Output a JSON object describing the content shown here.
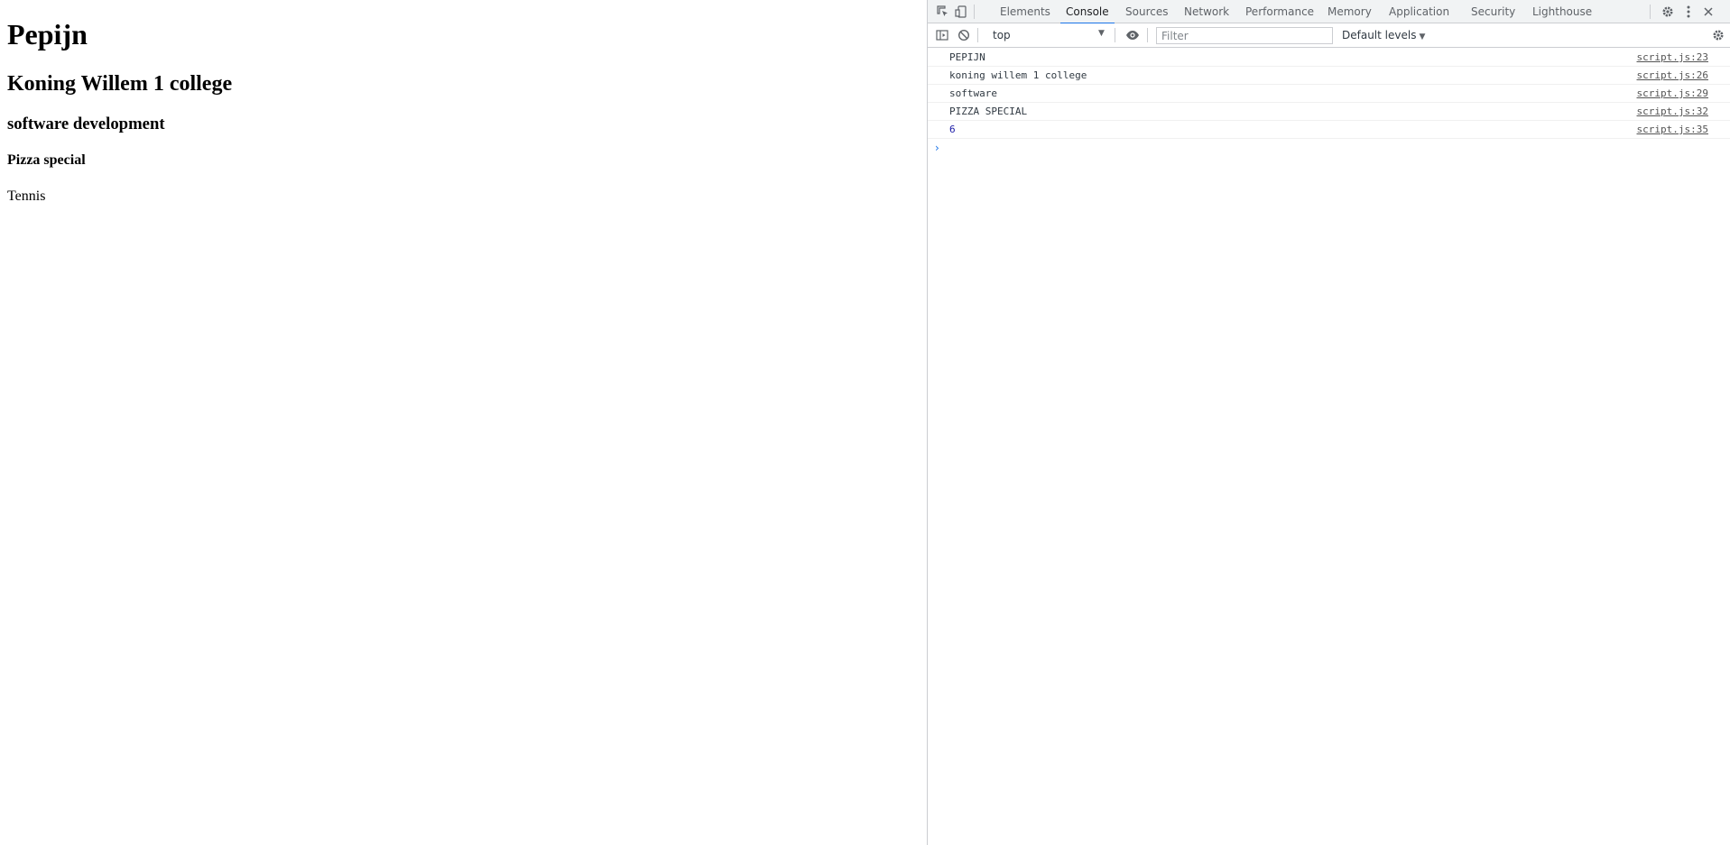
{
  "page": {
    "heading1": "Pepijn",
    "heading2": "Koning Willem 1 college",
    "heading3": "software development",
    "heading4": "Pizza special",
    "paragraph": "Tennis"
  },
  "devtools": {
    "tabs": [
      {
        "label": "Elements"
      },
      {
        "label": "Console"
      },
      {
        "label": "Sources"
      },
      {
        "label": "Network"
      },
      {
        "label": "Performance"
      },
      {
        "label": "Memory"
      },
      {
        "label": "Application"
      },
      {
        "label": "Security"
      },
      {
        "label": "Lighthouse"
      }
    ],
    "active_tab": "Console",
    "toolbar": {
      "context": "top",
      "filter_placeholder": "Filter",
      "levels": "Default levels"
    },
    "console": {
      "messages": [
        {
          "text": "PEPIJN",
          "source": "script.js:23"
        },
        {
          "text": "koning willem 1 college",
          "source": "script.js:26"
        },
        {
          "text": "software",
          "source": "script.js:29"
        },
        {
          "text": "PIZZA SPECIAL",
          "source": "script.js:32"
        },
        {
          "text": "6",
          "source": "script.js:35",
          "type": "number"
        }
      ],
      "prompt": "›"
    },
    "colors": {
      "accent": "#1a73e8",
      "number": "#1a1aa6",
      "toolbar_bg": "#f1f3f4"
    }
  }
}
